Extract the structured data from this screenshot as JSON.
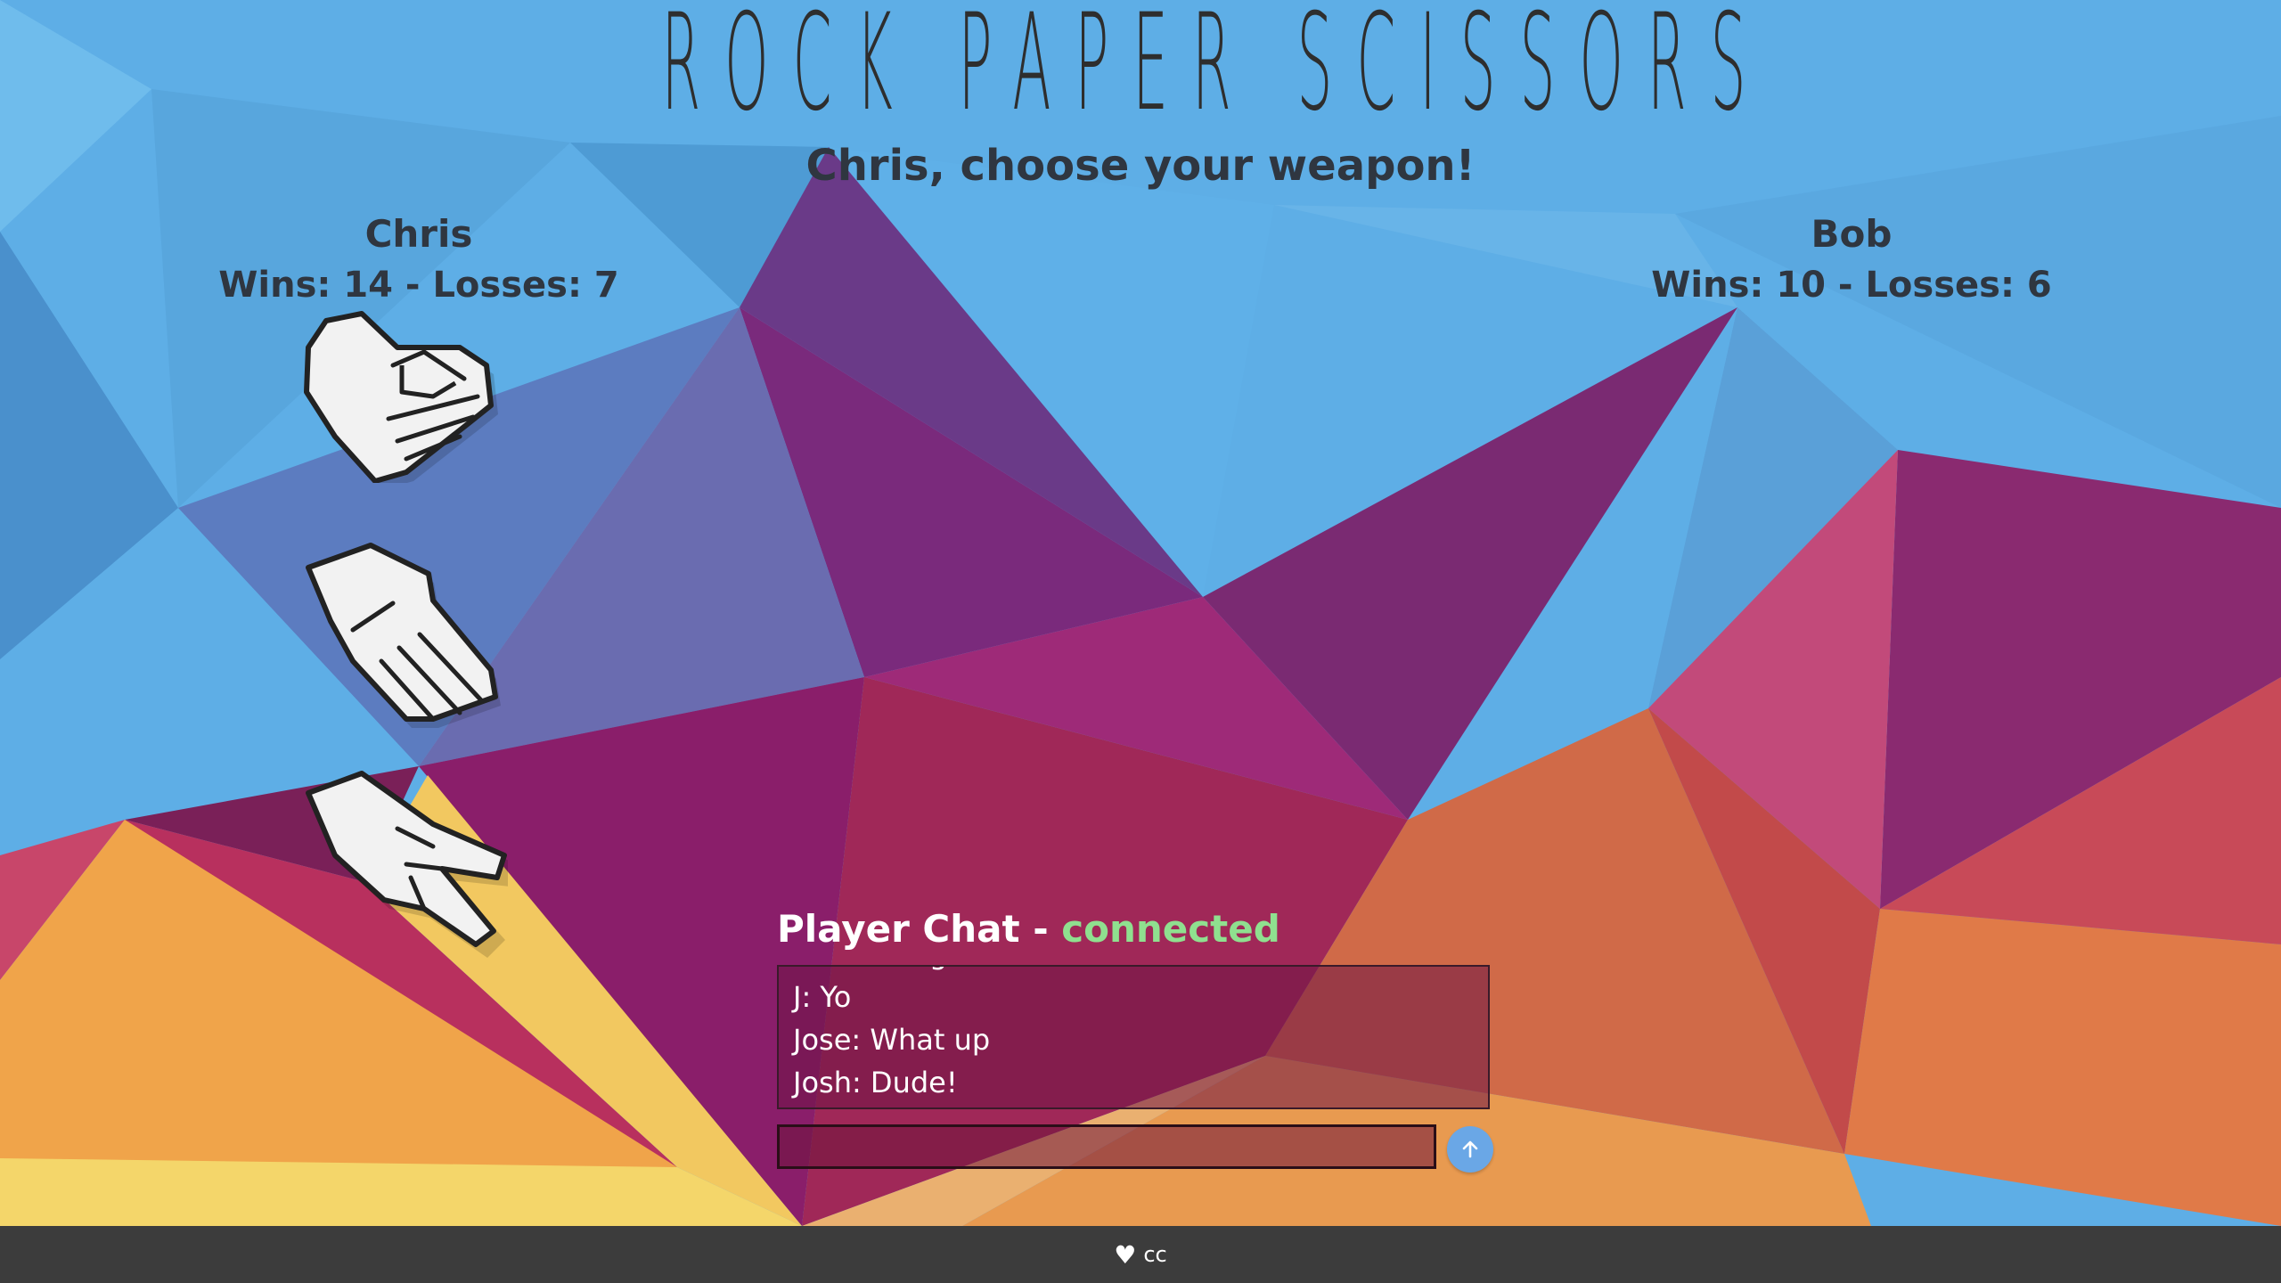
{
  "header": {
    "title": "ROCK PAPER SCISSORS",
    "prompt": "Chris, choose your weapon!"
  },
  "players": {
    "left": {
      "name": "Chris",
      "record": "Wins: 14 - Losses: 7"
    },
    "right": {
      "name": "Bob",
      "record": "Wins: 10 - Losses: 6"
    }
  },
  "weapons": [
    {
      "icon": "rock-hand-icon"
    },
    {
      "icon": "paper-hand-icon"
    },
    {
      "icon": "scissors-hand-icon"
    }
  ],
  "chat": {
    "title": "Player Chat - ",
    "status": "connected",
    "messages": [
      "Chris: omg hi",
      "J: Yo",
      "Jose: What up",
      "Josh: Dude!"
    ],
    "input_value": "",
    "send_icon": "arrow-up-icon"
  },
  "footer": {
    "icon": "heart-icon",
    "text": "cc"
  },
  "colors": {
    "title": "#2e2e2e",
    "status": "#8fe08f",
    "send_button": "#6aa7e6",
    "footer": "#3c3c3c"
  }
}
